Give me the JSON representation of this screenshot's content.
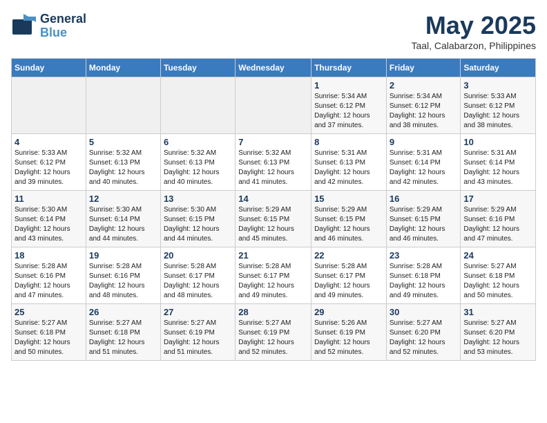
{
  "header": {
    "logo_line1": "General",
    "logo_line2": "Blue",
    "month": "May 2025",
    "location": "Taal, Calabarzon, Philippines"
  },
  "weekdays": [
    "Sunday",
    "Monday",
    "Tuesday",
    "Wednesday",
    "Thursday",
    "Friday",
    "Saturday"
  ],
  "weeks": [
    [
      {
        "day": "",
        "info": ""
      },
      {
        "day": "",
        "info": ""
      },
      {
        "day": "",
        "info": ""
      },
      {
        "day": "",
        "info": ""
      },
      {
        "day": "1",
        "info": "Sunrise: 5:34 AM\nSunset: 6:12 PM\nDaylight: 12 hours\nand 37 minutes."
      },
      {
        "day": "2",
        "info": "Sunrise: 5:34 AM\nSunset: 6:12 PM\nDaylight: 12 hours\nand 38 minutes."
      },
      {
        "day": "3",
        "info": "Sunrise: 5:33 AM\nSunset: 6:12 PM\nDaylight: 12 hours\nand 38 minutes."
      }
    ],
    [
      {
        "day": "4",
        "info": "Sunrise: 5:33 AM\nSunset: 6:12 PM\nDaylight: 12 hours\nand 39 minutes."
      },
      {
        "day": "5",
        "info": "Sunrise: 5:32 AM\nSunset: 6:13 PM\nDaylight: 12 hours\nand 40 minutes."
      },
      {
        "day": "6",
        "info": "Sunrise: 5:32 AM\nSunset: 6:13 PM\nDaylight: 12 hours\nand 40 minutes."
      },
      {
        "day": "7",
        "info": "Sunrise: 5:32 AM\nSunset: 6:13 PM\nDaylight: 12 hours\nand 41 minutes."
      },
      {
        "day": "8",
        "info": "Sunrise: 5:31 AM\nSunset: 6:13 PM\nDaylight: 12 hours\nand 42 minutes."
      },
      {
        "day": "9",
        "info": "Sunrise: 5:31 AM\nSunset: 6:14 PM\nDaylight: 12 hours\nand 42 minutes."
      },
      {
        "day": "10",
        "info": "Sunrise: 5:31 AM\nSunset: 6:14 PM\nDaylight: 12 hours\nand 43 minutes."
      }
    ],
    [
      {
        "day": "11",
        "info": "Sunrise: 5:30 AM\nSunset: 6:14 PM\nDaylight: 12 hours\nand 43 minutes."
      },
      {
        "day": "12",
        "info": "Sunrise: 5:30 AM\nSunset: 6:14 PM\nDaylight: 12 hours\nand 44 minutes."
      },
      {
        "day": "13",
        "info": "Sunrise: 5:30 AM\nSunset: 6:15 PM\nDaylight: 12 hours\nand 44 minutes."
      },
      {
        "day": "14",
        "info": "Sunrise: 5:29 AM\nSunset: 6:15 PM\nDaylight: 12 hours\nand 45 minutes."
      },
      {
        "day": "15",
        "info": "Sunrise: 5:29 AM\nSunset: 6:15 PM\nDaylight: 12 hours\nand 46 minutes."
      },
      {
        "day": "16",
        "info": "Sunrise: 5:29 AM\nSunset: 6:15 PM\nDaylight: 12 hours\nand 46 minutes."
      },
      {
        "day": "17",
        "info": "Sunrise: 5:29 AM\nSunset: 6:16 PM\nDaylight: 12 hours\nand 47 minutes."
      }
    ],
    [
      {
        "day": "18",
        "info": "Sunrise: 5:28 AM\nSunset: 6:16 PM\nDaylight: 12 hours\nand 47 minutes."
      },
      {
        "day": "19",
        "info": "Sunrise: 5:28 AM\nSunset: 6:16 PM\nDaylight: 12 hours\nand 48 minutes."
      },
      {
        "day": "20",
        "info": "Sunrise: 5:28 AM\nSunset: 6:17 PM\nDaylight: 12 hours\nand 48 minutes."
      },
      {
        "day": "21",
        "info": "Sunrise: 5:28 AM\nSunset: 6:17 PM\nDaylight: 12 hours\nand 49 minutes."
      },
      {
        "day": "22",
        "info": "Sunrise: 5:28 AM\nSunset: 6:17 PM\nDaylight: 12 hours\nand 49 minutes."
      },
      {
        "day": "23",
        "info": "Sunrise: 5:28 AM\nSunset: 6:18 PM\nDaylight: 12 hours\nand 49 minutes."
      },
      {
        "day": "24",
        "info": "Sunrise: 5:27 AM\nSunset: 6:18 PM\nDaylight: 12 hours\nand 50 minutes."
      }
    ],
    [
      {
        "day": "25",
        "info": "Sunrise: 5:27 AM\nSunset: 6:18 PM\nDaylight: 12 hours\nand 50 minutes."
      },
      {
        "day": "26",
        "info": "Sunrise: 5:27 AM\nSunset: 6:18 PM\nDaylight: 12 hours\nand 51 minutes."
      },
      {
        "day": "27",
        "info": "Sunrise: 5:27 AM\nSunset: 6:19 PM\nDaylight: 12 hours\nand 51 minutes."
      },
      {
        "day": "28",
        "info": "Sunrise: 5:27 AM\nSunset: 6:19 PM\nDaylight: 12 hours\nand 52 minutes."
      },
      {
        "day": "29",
        "info": "Sunrise: 5:26 AM\nSunset: 6:19 PM\nDaylight: 12 hours\nand 52 minutes."
      },
      {
        "day": "30",
        "info": "Sunrise: 5:27 AM\nSunset: 6:20 PM\nDaylight: 12 hours\nand 52 minutes."
      },
      {
        "day": "31",
        "info": "Sunrise: 5:27 AM\nSunset: 6:20 PM\nDaylight: 12 hours\nand 53 minutes."
      }
    ]
  ]
}
